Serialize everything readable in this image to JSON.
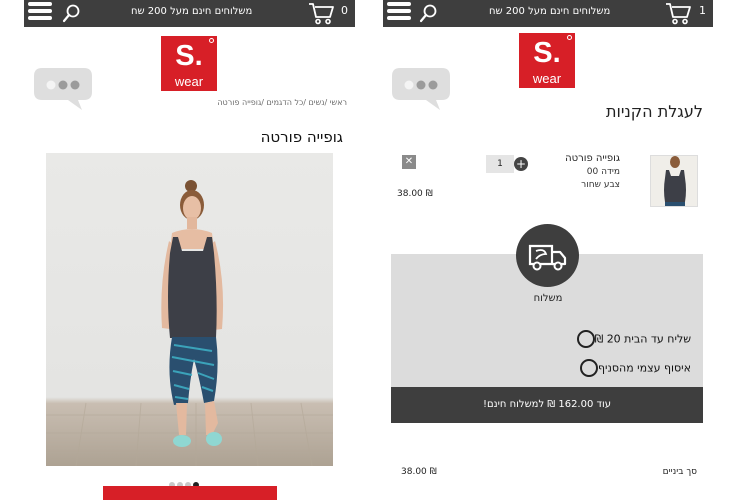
{
  "header": {
    "promo": "משלוחים חינם מעל 200 שח"
  },
  "logo": {
    "mark": "S.",
    "word": "wear"
  },
  "product_page": {
    "cart_count": "0",
    "breadcrumb": "ראשי /נשים /כל הדגמים /גופייה פורטה",
    "title": "גופייה פורטה",
    "gallery_dots": 4,
    "active_dot": 3
  },
  "cart_page": {
    "cart_count": "1",
    "title": "לעגלת הקניות",
    "item": {
      "name": "גופייה פורטה",
      "size": "מידה 00",
      "color": "צבע  שחור",
      "quantity": "1",
      "price": "₪ 38.00"
    },
    "shipping": {
      "label": "משלוח",
      "option_home": "שליח עד הבית 20 ₪",
      "option_pickup": "איסוף עצמי מהסניף"
    },
    "free_shipping_msg": "עוד 162.00 ₪ למשלוח חינם!",
    "subtotal_label": "סך ביניים",
    "subtotal_value": "₪ 38.00"
  },
  "colors": {
    "topbar": "#3e3e3e",
    "brand_red": "#d71f27",
    "panel_gray": "#dcdcdc"
  },
  "icons": [
    "menu-icon",
    "search-icon",
    "cart-icon",
    "chat-bubble-icon",
    "plus-icon",
    "remove-icon",
    "delivery-truck-icon"
  ]
}
